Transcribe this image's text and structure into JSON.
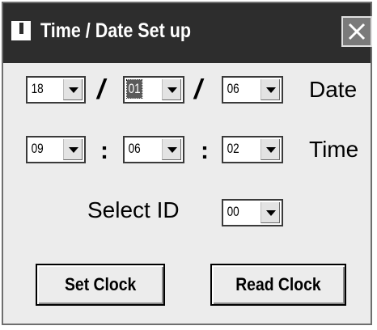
{
  "window": {
    "title": "Time / Date Set up",
    "close_icon": "close-icon"
  },
  "date": {
    "day": "18",
    "month": "01",
    "year": "06",
    "separator": "/",
    "label": "Date"
  },
  "time": {
    "hour": "09",
    "minute": "06",
    "second": "02",
    "separator": ":",
    "label": "Time"
  },
  "select_id": {
    "label": "Select ID",
    "value": "00"
  },
  "buttons": {
    "set_clock": "Set Clock",
    "read_clock": "Read Clock"
  }
}
